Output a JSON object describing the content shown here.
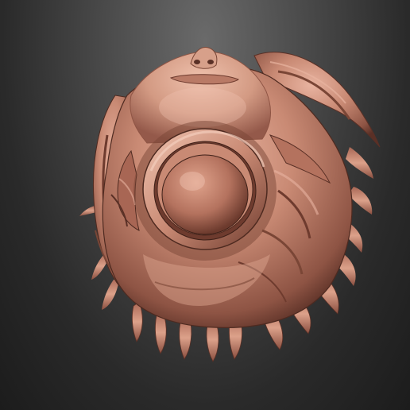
{
  "scene": {
    "subject": "sculpt-bust-bottom-view",
    "colors": {
      "background_top": "#6a6a6a",
      "background_bottom": "#1c1c1c",
      "clay_base": "#c98a74",
      "clay_highlight": "#e8b3a0",
      "clay_shadow": "#7a4636",
      "clay_dark": "#4e2a20"
    }
  }
}
